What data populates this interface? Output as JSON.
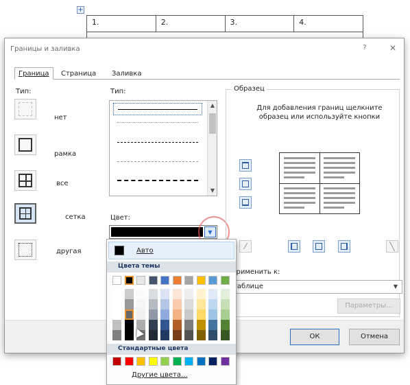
{
  "table": {
    "move_handle": "+",
    "cells": [
      "1.",
      "2.",
      "3.",
      "4."
    ]
  },
  "dialog": {
    "title": "Границы и заливка",
    "help": "?",
    "close": "✕",
    "tabs": [
      {
        "label": "Граница",
        "active": true
      },
      {
        "label": "Страница",
        "active": false
      },
      {
        "label": "Заливка",
        "active": false
      }
    ],
    "setting_label": "Тип:",
    "settings": [
      {
        "label": "нет",
        "selected": false
      },
      {
        "label": "рамка",
        "selected": false
      },
      {
        "label": "все",
        "selected": false
      },
      {
        "label": "сетка",
        "selected": true
      },
      {
        "label": "другая",
        "selected": false
      }
    ],
    "style_label": "Тип:",
    "styles": [
      "solid",
      "dotted",
      "dashed-fine",
      "dashed",
      "dash-dot"
    ],
    "color_label": "Цвет:",
    "color_value": "#000000",
    "preview_label": "Образец",
    "preview_hint": "Для добавления границ щелкните образец или используйте кнопки",
    "apply_label": "Применить к:",
    "apply_value": "таблице",
    "params_label": "Параметры...",
    "ok": "ОК",
    "cancel": "Отмена"
  },
  "color_menu": {
    "auto_label": "Авто",
    "theme_header": "Цвета темы",
    "standard_header": "Стандартные цвета",
    "more_colors": "Другие цвета...",
    "theme_top": [
      "#ffffff",
      "#000000",
      "#e7e6e6",
      "#44546a",
      "#4472c4",
      "#ed7d31",
      "#a5a5a5",
      "#ffc000",
      "#5b9bd5",
      "#70ad47"
    ],
    "standard": [
      "#c00000",
      "#ff0000",
      "#ffc000",
      "#ffff00",
      "#92d050",
      "#00b050",
      "#00b0f0",
      "#0070c0",
      "#002060",
      "#7030a0"
    ]
  }
}
